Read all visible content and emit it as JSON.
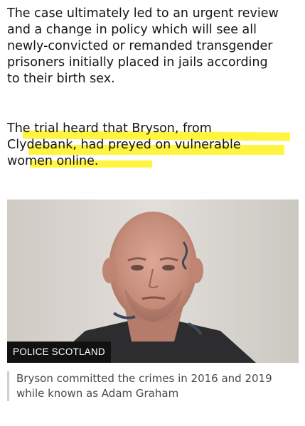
{
  "article": {
    "paragraph1_lines": [
      "The case ultimately led to an urgent review",
      "and a change in policy which will see all",
      "newly-convicted or remanded transgender",
      "prisoners initially placed in jails according",
      "to their birth sex."
    ],
    "paragraph2_lines": [
      "The trial heard that Bryson, from",
      "Clydebank, had preyed on vulnerable",
      "women online."
    ],
    "highlight_color": "#fff200"
  },
  "image": {
    "credit": "POLICE SCOTLAND",
    "caption_lines": [
      "Bryson committed the crimes in 2016 and 2019",
      "while known as Adam Graham"
    ]
  }
}
